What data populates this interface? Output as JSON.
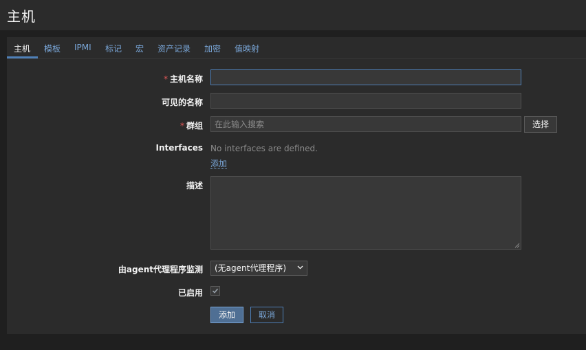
{
  "page": {
    "title": "主机"
  },
  "tabs": [
    {
      "label": "主机"
    },
    {
      "label": "模板"
    },
    {
      "label": "IPMI"
    },
    {
      "label": "标记"
    },
    {
      "label": "宏"
    },
    {
      "label": "资产记录"
    },
    {
      "label": "加密"
    },
    {
      "label": "值映射"
    }
  ],
  "form": {
    "required_mark": "*",
    "host_name": {
      "label": "主机名称",
      "value": ""
    },
    "visible_name": {
      "label": "可见的名称",
      "value": ""
    },
    "groups": {
      "label": "群组",
      "placeholder": "在此输入搜索",
      "select_button": "选择"
    },
    "interfaces": {
      "label": "Interfaces",
      "empty_text": "No interfaces are defined.",
      "add_link": "添加"
    },
    "description": {
      "label": "描述"
    },
    "monitored_by": {
      "label": "由agent代理程序监测",
      "selected": "(无agent代理程序)"
    },
    "enabled": {
      "label": "已启用",
      "checked": true
    },
    "buttons": {
      "add": "添加",
      "cancel": "取消"
    }
  },
  "colors": {
    "background": "#1f1f1f",
    "panel": "#2b2b2b",
    "accent": "#7aa7d9",
    "required": "#e45959"
  }
}
